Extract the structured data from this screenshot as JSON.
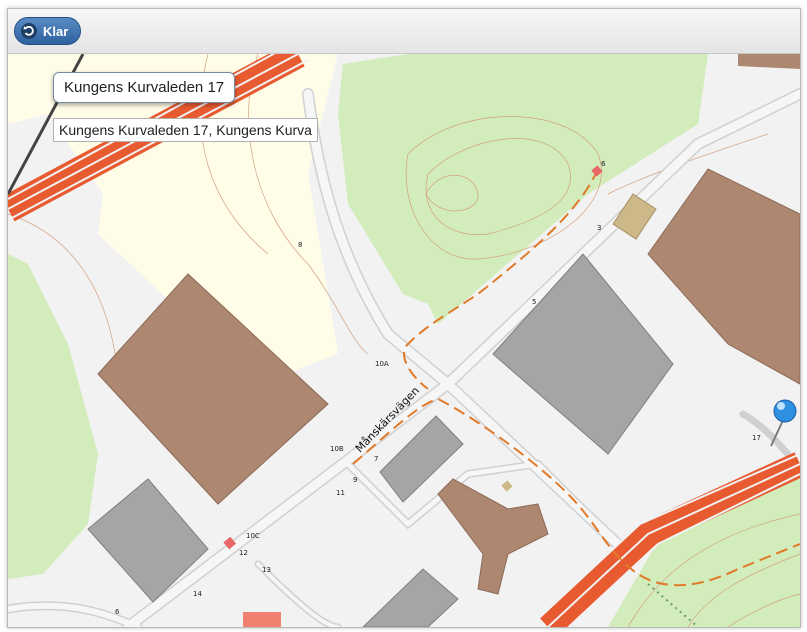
{
  "toolbar": {
    "back_label": "Klar",
    "back_icon": "undo-arrow-icon"
  },
  "search": {
    "query": "Kungens Kurvaleden 17",
    "suggestion": "Kungens Kurvaleden 17, Kungens Kurva"
  },
  "map": {
    "street_name": "Månskärsvägen",
    "house_numbers": {
      "n8": "8",
      "n6a": "6",
      "n3": "3",
      "n5": "5",
      "n10a": "10A",
      "n10b": "10B",
      "n7": "7",
      "n9": "9",
      "n11": "11",
      "n10c": "10C",
      "n12": "12",
      "n13": "13",
      "n14": "14",
      "n6b": "6",
      "n17": "17"
    },
    "colors": {
      "background": "#f2f2f2",
      "green_area": "#d3ecbb",
      "building_brown": "#ad8770",
      "building_gray": "#a5a5a5",
      "highway": "#e85a30",
      "footpath": "#e07a2a",
      "contour": "#d2a080",
      "yellow_area": "#fffce8"
    },
    "marker_icon": "map-pin-icon"
  }
}
